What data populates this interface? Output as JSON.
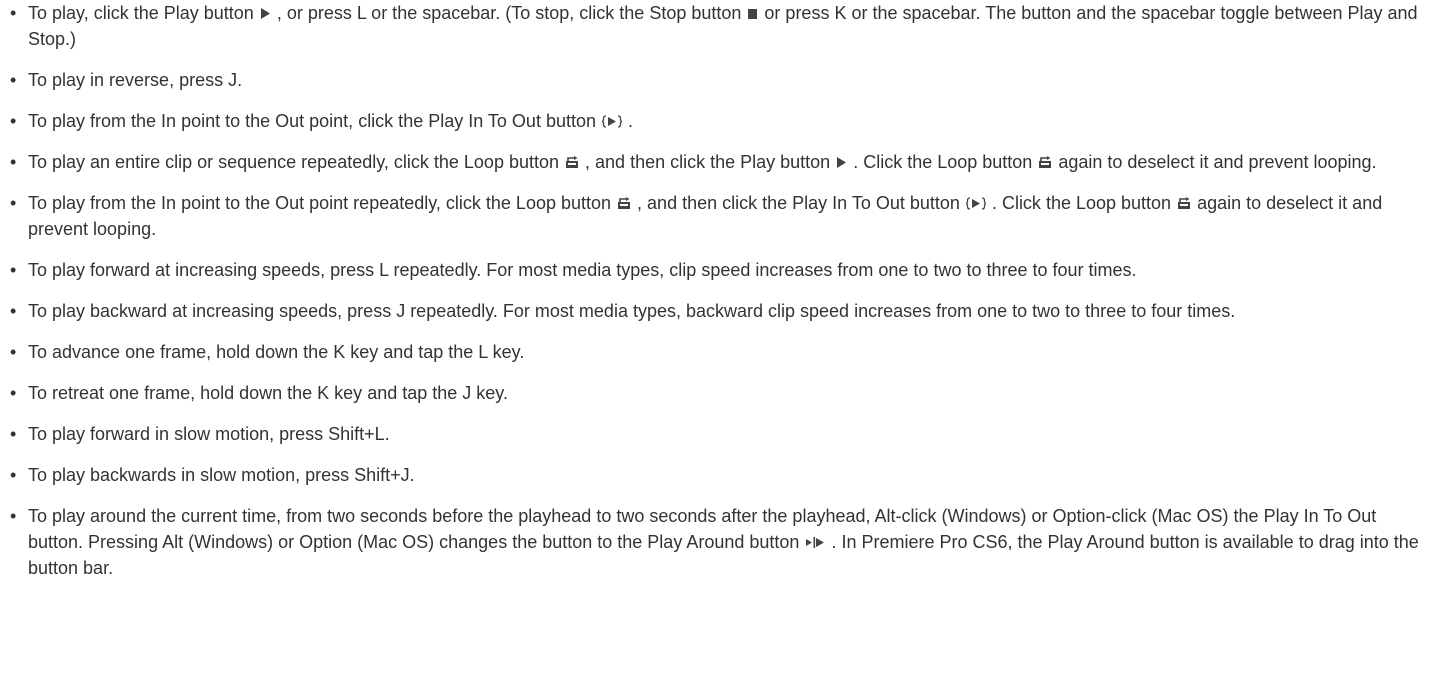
{
  "icons": {
    "play": "play-triangle-icon",
    "stop": "stop-square-icon",
    "play_in_to_out": "play-in-to-out-icon",
    "loop": "loop-icon",
    "play_around": "play-around-icon"
  },
  "colors": {
    "text": "#333333",
    "icon": "#444444"
  },
  "items": [
    {
      "t1": "To play, click the Play button ",
      "t2": ", or press L or the spacebar. (To stop, click the Stop button ",
      "t3": " or press K or the spacebar. The button and the spacebar toggle between Play and Stop.)"
    },
    {
      "t1": "To play in reverse, press J."
    },
    {
      "t1": "To play from the In point to the Out point, click the Play In To Out button ",
      "t2": "."
    },
    {
      "t1": "To play an entire clip or sequence repeatedly, click the Loop button ",
      "t2": ", and then click the Play button ",
      "t3": ". Click the Loop button ",
      "t4": " again to deselect it and prevent looping."
    },
    {
      "t1": "To play from the In point to the Out point repeatedly, click the Loop button ",
      "t2": ", and then click the Play In To Out button ",
      "t3": ". Click the Loop button ",
      "t4": " again to deselect it and prevent looping."
    },
    {
      "t1": "To play forward at increasing speeds, press L repeatedly. For most media types, clip speed increases from one to two to three to four times."
    },
    {
      "t1": "To play backward at increasing speeds, press J repeatedly. For most media types, backward clip speed increases from one to two to three to four times."
    },
    {
      "t1": "To advance one frame, hold down the K key and tap the L key."
    },
    {
      "t1": "To retreat one frame, hold down the K key and tap the J key."
    },
    {
      "t1": "To play forward in slow motion, press Shift+L."
    },
    {
      "t1": "To play backwards in slow motion, press Shift+J."
    },
    {
      "t1": "To play around the current time, from two seconds before the playhead to two seconds after the playhead, Alt-click (Windows) or Option-click (Mac OS) the Play In To Out button. Pressing Alt (Windows) or Option (Mac OS) changes the button to the Play Around button ",
      "t2": ". In Premiere Pro CS6, the Play Around button is available to drag into the button bar."
    }
  ]
}
